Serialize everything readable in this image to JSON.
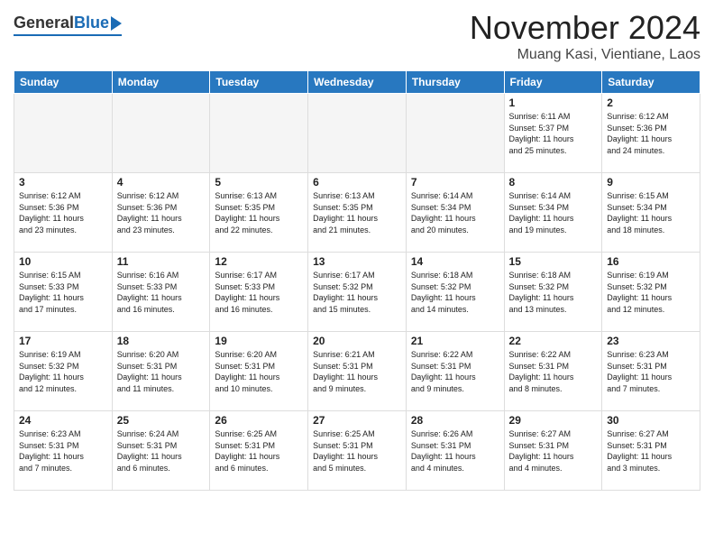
{
  "header": {
    "logo_general": "General",
    "logo_blue": "Blue",
    "month": "November 2024",
    "location": "Muang Kasi, Vientiane, Laos"
  },
  "weekdays": [
    "Sunday",
    "Monday",
    "Tuesday",
    "Wednesday",
    "Thursday",
    "Friday",
    "Saturday"
  ],
  "weeks": [
    [
      {
        "day": "",
        "text": ""
      },
      {
        "day": "",
        "text": ""
      },
      {
        "day": "",
        "text": ""
      },
      {
        "day": "",
        "text": ""
      },
      {
        "day": "",
        "text": ""
      },
      {
        "day": "1",
        "text": "Sunrise: 6:11 AM\nSunset: 5:37 PM\nDaylight: 11 hours\nand 25 minutes."
      },
      {
        "day": "2",
        "text": "Sunrise: 6:12 AM\nSunset: 5:36 PM\nDaylight: 11 hours\nand 24 minutes."
      }
    ],
    [
      {
        "day": "3",
        "text": "Sunrise: 6:12 AM\nSunset: 5:36 PM\nDaylight: 11 hours\nand 23 minutes."
      },
      {
        "day": "4",
        "text": "Sunrise: 6:12 AM\nSunset: 5:36 PM\nDaylight: 11 hours\nand 23 minutes."
      },
      {
        "day": "5",
        "text": "Sunrise: 6:13 AM\nSunset: 5:35 PM\nDaylight: 11 hours\nand 22 minutes."
      },
      {
        "day": "6",
        "text": "Sunrise: 6:13 AM\nSunset: 5:35 PM\nDaylight: 11 hours\nand 21 minutes."
      },
      {
        "day": "7",
        "text": "Sunrise: 6:14 AM\nSunset: 5:34 PM\nDaylight: 11 hours\nand 20 minutes."
      },
      {
        "day": "8",
        "text": "Sunrise: 6:14 AM\nSunset: 5:34 PM\nDaylight: 11 hours\nand 19 minutes."
      },
      {
        "day": "9",
        "text": "Sunrise: 6:15 AM\nSunset: 5:34 PM\nDaylight: 11 hours\nand 18 minutes."
      }
    ],
    [
      {
        "day": "10",
        "text": "Sunrise: 6:15 AM\nSunset: 5:33 PM\nDaylight: 11 hours\nand 17 minutes."
      },
      {
        "day": "11",
        "text": "Sunrise: 6:16 AM\nSunset: 5:33 PM\nDaylight: 11 hours\nand 16 minutes."
      },
      {
        "day": "12",
        "text": "Sunrise: 6:17 AM\nSunset: 5:33 PM\nDaylight: 11 hours\nand 16 minutes."
      },
      {
        "day": "13",
        "text": "Sunrise: 6:17 AM\nSunset: 5:32 PM\nDaylight: 11 hours\nand 15 minutes."
      },
      {
        "day": "14",
        "text": "Sunrise: 6:18 AM\nSunset: 5:32 PM\nDaylight: 11 hours\nand 14 minutes."
      },
      {
        "day": "15",
        "text": "Sunrise: 6:18 AM\nSunset: 5:32 PM\nDaylight: 11 hours\nand 13 minutes."
      },
      {
        "day": "16",
        "text": "Sunrise: 6:19 AM\nSunset: 5:32 PM\nDaylight: 11 hours\nand 12 minutes."
      }
    ],
    [
      {
        "day": "17",
        "text": "Sunrise: 6:19 AM\nSunset: 5:32 PM\nDaylight: 11 hours\nand 12 minutes."
      },
      {
        "day": "18",
        "text": "Sunrise: 6:20 AM\nSunset: 5:31 PM\nDaylight: 11 hours\nand 11 minutes."
      },
      {
        "day": "19",
        "text": "Sunrise: 6:20 AM\nSunset: 5:31 PM\nDaylight: 11 hours\nand 10 minutes."
      },
      {
        "day": "20",
        "text": "Sunrise: 6:21 AM\nSunset: 5:31 PM\nDaylight: 11 hours\nand 9 minutes."
      },
      {
        "day": "21",
        "text": "Sunrise: 6:22 AM\nSunset: 5:31 PM\nDaylight: 11 hours\nand 9 minutes."
      },
      {
        "day": "22",
        "text": "Sunrise: 6:22 AM\nSunset: 5:31 PM\nDaylight: 11 hours\nand 8 minutes."
      },
      {
        "day": "23",
        "text": "Sunrise: 6:23 AM\nSunset: 5:31 PM\nDaylight: 11 hours\nand 7 minutes."
      }
    ],
    [
      {
        "day": "24",
        "text": "Sunrise: 6:23 AM\nSunset: 5:31 PM\nDaylight: 11 hours\nand 7 minutes."
      },
      {
        "day": "25",
        "text": "Sunrise: 6:24 AM\nSunset: 5:31 PM\nDaylight: 11 hours\nand 6 minutes."
      },
      {
        "day": "26",
        "text": "Sunrise: 6:25 AM\nSunset: 5:31 PM\nDaylight: 11 hours\nand 6 minutes."
      },
      {
        "day": "27",
        "text": "Sunrise: 6:25 AM\nSunset: 5:31 PM\nDaylight: 11 hours\nand 5 minutes."
      },
      {
        "day": "28",
        "text": "Sunrise: 6:26 AM\nSunset: 5:31 PM\nDaylight: 11 hours\nand 4 minutes."
      },
      {
        "day": "29",
        "text": "Sunrise: 6:27 AM\nSunset: 5:31 PM\nDaylight: 11 hours\nand 4 minutes."
      },
      {
        "day": "30",
        "text": "Sunrise: 6:27 AM\nSunset: 5:31 PM\nDaylight: 11 hours\nand 3 minutes."
      }
    ]
  ]
}
